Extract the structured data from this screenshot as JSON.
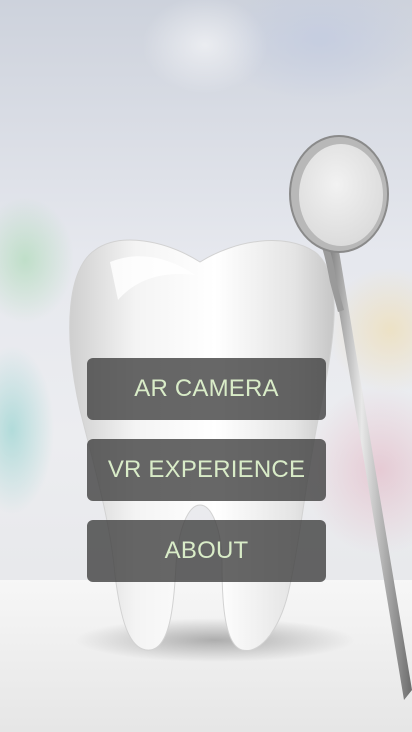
{
  "menu": {
    "ar_camera_label": "AR CAMERA",
    "vr_experience_label": "VR EXPERIENCE",
    "about_label": "ABOUT"
  },
  "colors": {
    "button_background": "#3c3c3c",
    "button_text": "#d9ecc8"
  },
  "background": {
    "image": "dental-tooth-and-mouth-mirror-illustration"
  }
}
